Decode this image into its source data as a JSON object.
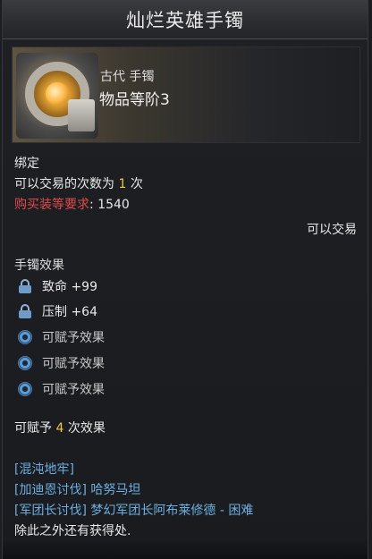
{
  "title": "灿烂英雄手镯",
  "item": {
    "type": "古代 手镯",
    "tier": "物品等阶3",
    "icon": "bracelet-icon"
  },
  "binding": "绑定",
  "trade_count": {
    "prefix": "可以交易的次数为",
    "value": "1",
    "suffix": "次"
  },
  "purchase_requirement": {
    "label": "购买装等要求",
    "value": ": 1540"
  },
  "tradeable": "可以交易",
  "effects": {
    "title": "手镯效果",
    "locked": [
      {
        "label": "致命 +99",
        "icon": "lock-icon"
      },
      {
        "label": "压制 +64",
        "icon": "lock-icon"
      }
    ],
    "slots": [
      {
        "label": "可赋予效果",
        "icon": "gear-icon"
      },
      {
        "label": "可赋予效果",
        "icon": "gear-icon"
      },
      {
        "label": "可赋予效果",
        "icon": "gear-icon"
      }
    ]
  },
  "grant_count": {
    "prefix": "可赋予",
    "value": "4",
    "suffix": "次效果"
  },
  "sources": [
    {
      "bracket": "[混沌地牢]",
      "text": ""
    },
    {
      "bracket": "[加迪恩讨伐]",
      "text": "哈努马坦"
    },
    {
      "bracket": "[军团长讨伐]",
      "text": "梦幻军团长阿布莱修德 - 困难"
    }
  ],
  "sources_more": "除此之外还有获得处.",
  "colors": {
    "highlight": "#f0c83c",
    "requirement": "#e04a4a",
    "link": "#6cb0e0",
    "lock": "#6f9bc8"
  }
}
